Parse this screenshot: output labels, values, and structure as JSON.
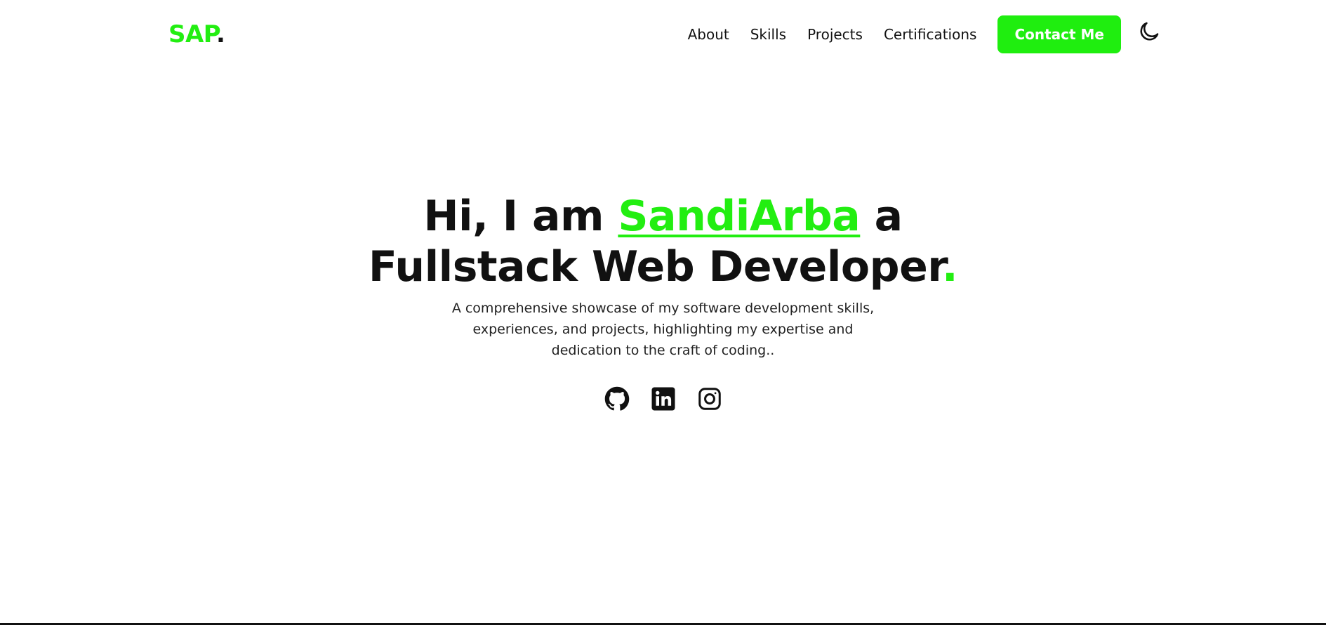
{
  "header": {
    "logo_text": "SAP",
    "logo_dot": ".",
    "nav": [
      {
        "label": "About"
      },
      {
        "label": "Skills"
      },
      {
        "label": "Projects"
      },
      {
        "label": "Certifications"
      }
    ],
    "contact_label": "Contact Me",
    "theme_icon": "moon-icon"
  },
  "hero": {
    "title_prefix": "Hi, I am ",
    "title_name": "SandiArba",
    "title_suffix": " a",
    "title_line2": "Fullstack Web Developer",
    "title_dot": ".",
    "description": "A comprehensive showcase of my software development skills, experiences, and projects, highlighting my expertise and dedication to the craft of coding..",
    "socials": [
      {
        "icon": "github-icon"
      },
      {
        "icon": "linkedin-icon"
      },
      {
        "icon": "instagram-icon"
      }
    ]
  },
  "colors": {
    "accent": "#22ee11",
    "text": "#111111",
    "background": "#ffffff"
  }
}
